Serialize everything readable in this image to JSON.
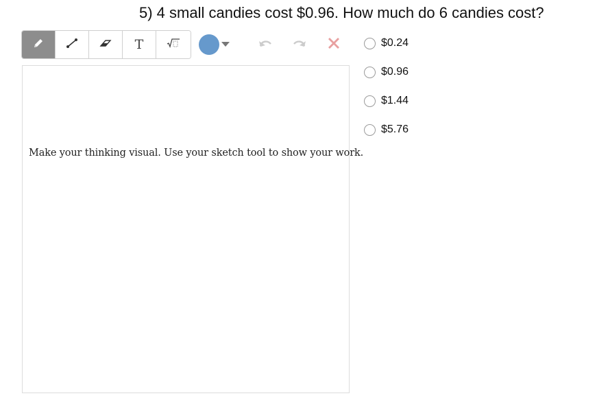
{
  "question": {
    "text": "5) 4 small candies cost $0.96. How much do 6 candies cost?"
  },
  "toolbar": {
    "tools": [
      {
        "icon": "pencil-icon",
        "name": "pencil",
        "active": true
      },
      {
        "icon": "line-icon",
        "name": "line",
        "active": false
      },
      {
        "icon": "eraser-icon",
        "name": "eraser",
        "active": false
      },
      {
        "icon": "text-icon",
        "name": "text",
        "glyph": "T",
        "active": false
      },
      {
        "icon": "math-icon",
        "name": "math",
        "active": false
      }
    ],
    "color": "#6699cc",
    "actions": [
      "undo-icon",
      "redo-icon",
      "clear-icon"
    ]
  },
  "canvas": {
    "note": "Make your thinking visual. Use your sketch tool to show your work."
  },
  "choices": [
    {
      "label": "$0.24",
      "selected": false
    },
    {
      "label": "$0.96",
      "selected": false
    },
    {
      "label": "$1.44",
      "selected": false
    },
    {
      "label": "$5.76",
      "selected": false
    }
  ],
  "colors": {
    "accent": "#6699cc",
    "active_tool": "#8d8d8d",
    "clear": "#e8a0a0",
    "disabled": "#cccccc"
  }
}
